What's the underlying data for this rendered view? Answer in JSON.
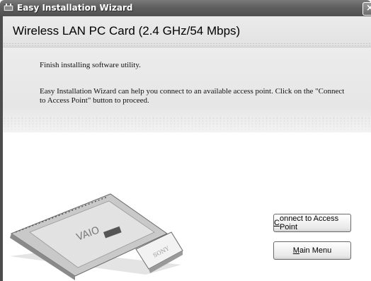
{
  "window": {
    "title": "Easy Installation Wizard",
    "close_glyph": "×"
  },
  "header": {
    "title": "Wireless LAN PC Card (2.4 GHz/54 Mbps)"
  },
  "message": {
    "line1": "Finish installing software utility.",
    "line2": "Easy Installation Wizard can help you connect to an available access point. Click on the \"Connect to Access Point\" button to proceed."
  },
  "buttons": {
    "connect_access_key": "C",
    "connect_rest": "onnect to Access Point",
    "main_access_key": "M",
    "main_rest": "ain Menu"
  },
  "illustration": {
    "brand_logo": "VAIO",
    "maker_logo": "SONY"
  },
  "colors": {
    "titlebar": "#5f5f5f",
    "header_bg": "#e6e6e6",
    "page_bg": "#ffffff"
  }
}
